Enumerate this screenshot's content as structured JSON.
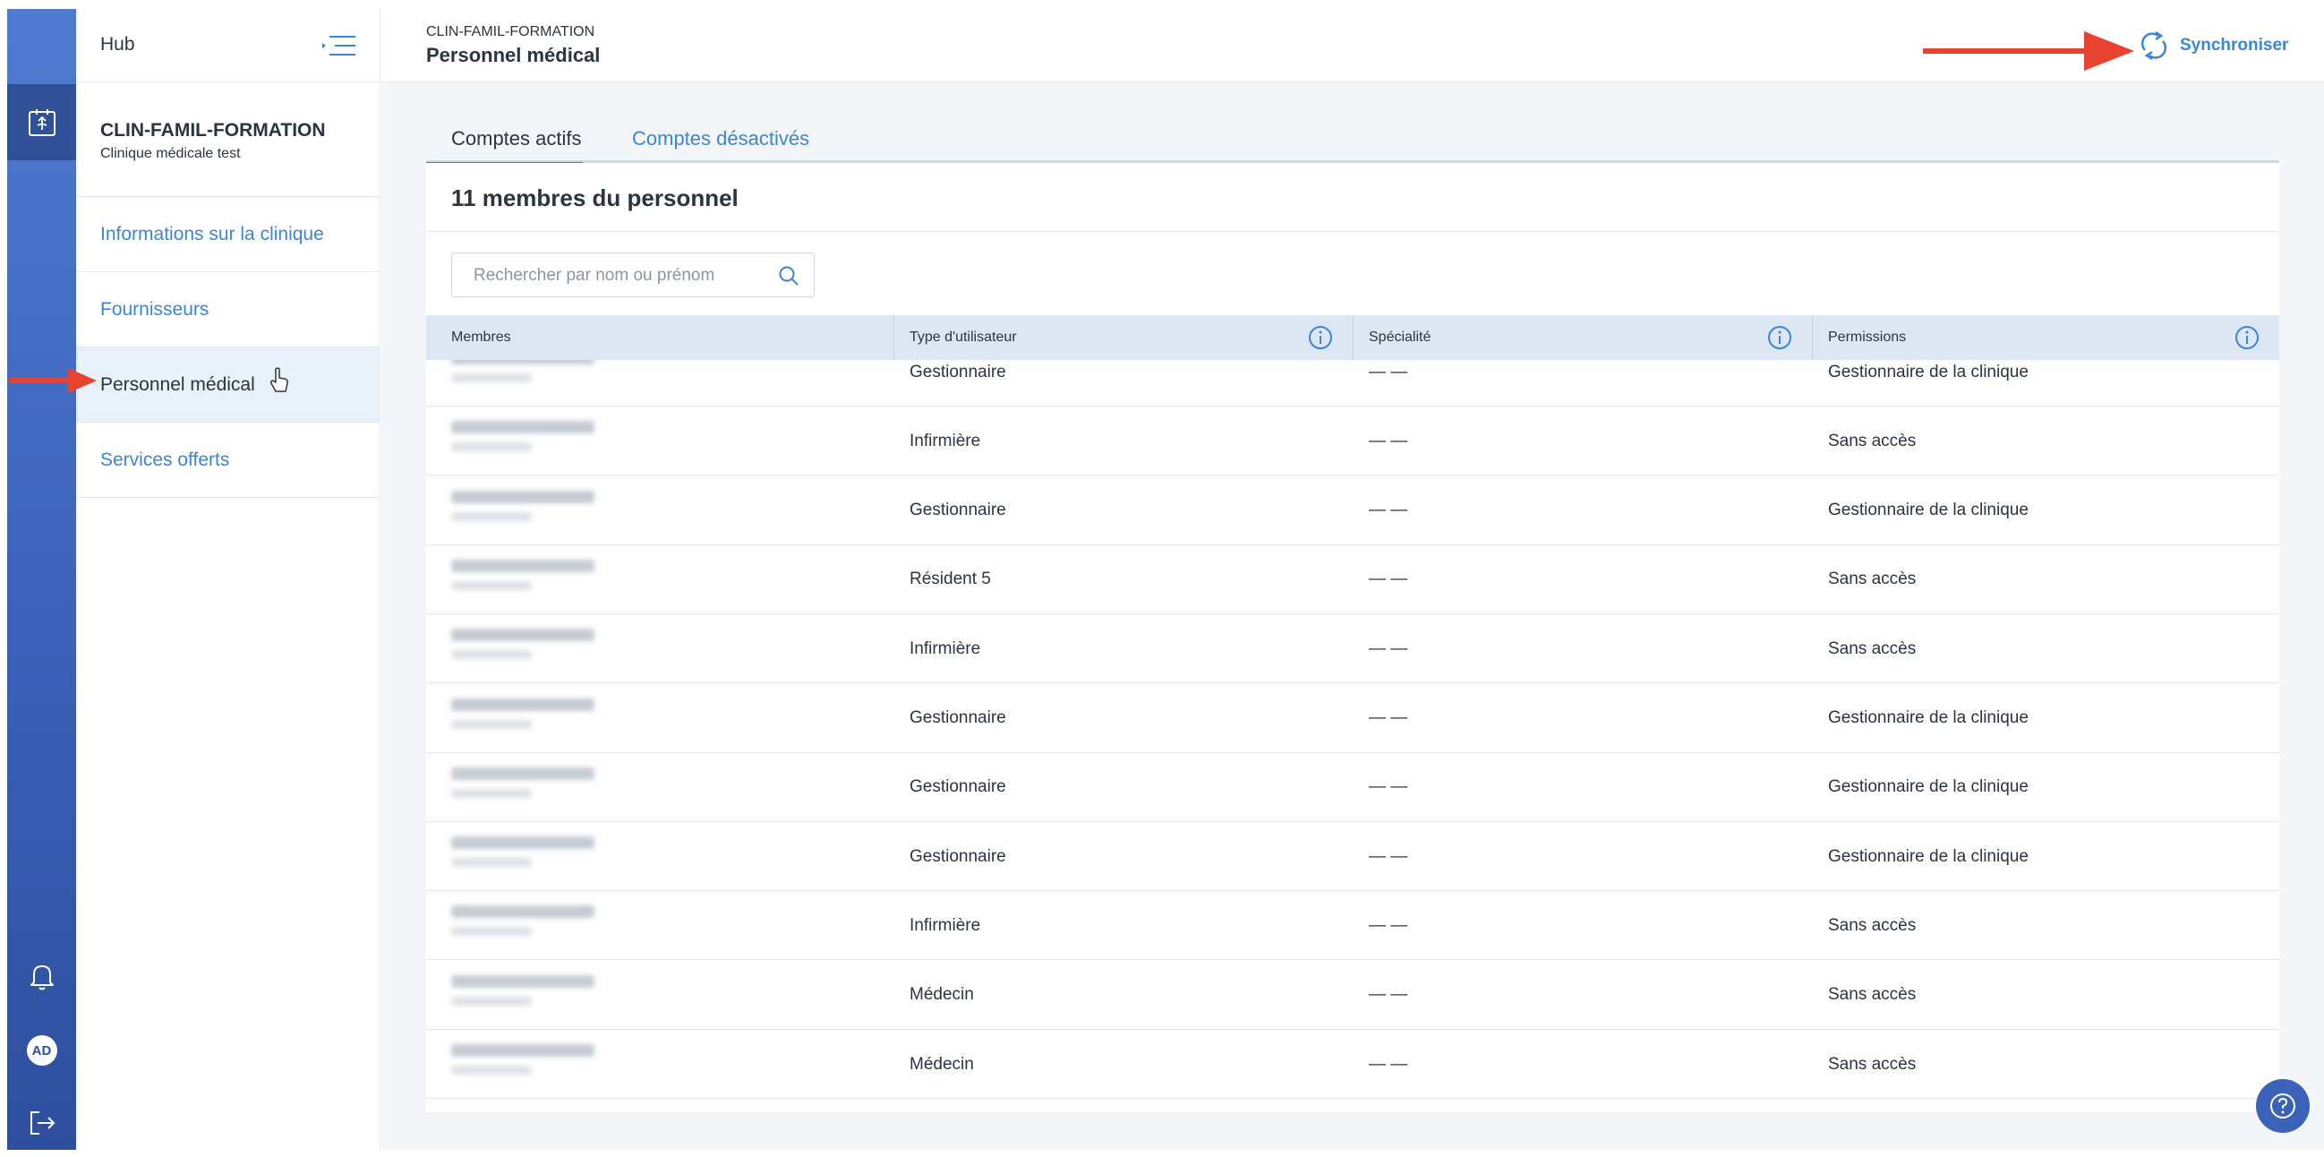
{
  "sidebar": {
    "hub_label": "Hub",
    "clinic_name": "CLIN-FAMIL-FORMATION",
    "clinic_subtitle": "Clinique médicale test",
    "nav_items": [
      {
        "label": "Informations sur la clinique",
        "active": false
      },
      {
        "label": "Fournisseurs",
        "active": false
      },
      {
        "label": "Personnel médical",
        "active": true
      },
      {
        "label": "Services offerts",
        "active": false
      }
    ]
  },
  "rail": {
    "avatar_initials": "AD",
    "icons": [
      "clinic-logo-icon",
      "bell-icon",
      "logout-icon"
    ]
  },
  "header": {
    "breadcrumb": "CLIN-FAMIL-FORMATION",
    "title": "Personnel médical",
    "sync_label": "Synchroniser"
  },
  "tabs": [
    {
      "label": "Comptes actifs",
      "active": true
    },
    {
      "label": "Comptes désactivés",
      "active": false
    }
  ],
  "card": {
    "title": "11 membres du personnel",
    "search_placeholder": "Rechercher par nom ou prénom"
  },
  "table": {
    "headers": [
      "Membres",
      "Type d'utilisateur",
      "Spécialité",
      "Permissions"
    ],
    "rows": [
      {
        "type": "Gestionnaire",
        "specialty": "— —",
        "permission": "Gestionnaire de la clinique"
      },
      {
        "type": "Infirmière",
        "specialty": "— —",
        "permission": "Sans accès"
      },
      {
        "type": "Gestionnaire",
        "specialty": "— —",
        "permission": "Gestionnaire de la clinique"
      },
      {
        "type": "Résident 5",
        "specialty": "— —",
        "permission": "Sans accès"
      },
      {
        "type": "Infirmière",
        "specialty": "— —",
        "permission": "Sans accès"
      },
      {
        "type": "Gestionnaire",
        "specialty": "— —",
        "permission": "Gestionnaire de la clinique"
      },
      {
        "type": "Gestionnaire",
        "specialty": "— —",
        "permission": "Gestionnaire de la clinique"
      },
      {
        "type": "Gestionnaire",
        "specialty": "— —",
        "permission": "Gestionnaire de la clinique"
      },
      {
        "type": "Infirmière",
        "specialty": "— —",
        "permission": "Sans accès"
      },
      {
        "type": "Médecin",
        "specialty": "— —",
        "permission": "Sans accès"
      },
      {
        "type": "Médecin",
        "specialty": "— —",
        "permission": "Sans accès"
      }
    ]
  },
  "colors": {
    "accent": "#3a86d6",
    "rail": "#3a62b8",
    "annotation_arrow": "#e8432e",
    "header_row": "#dde7f4"
  }
}
